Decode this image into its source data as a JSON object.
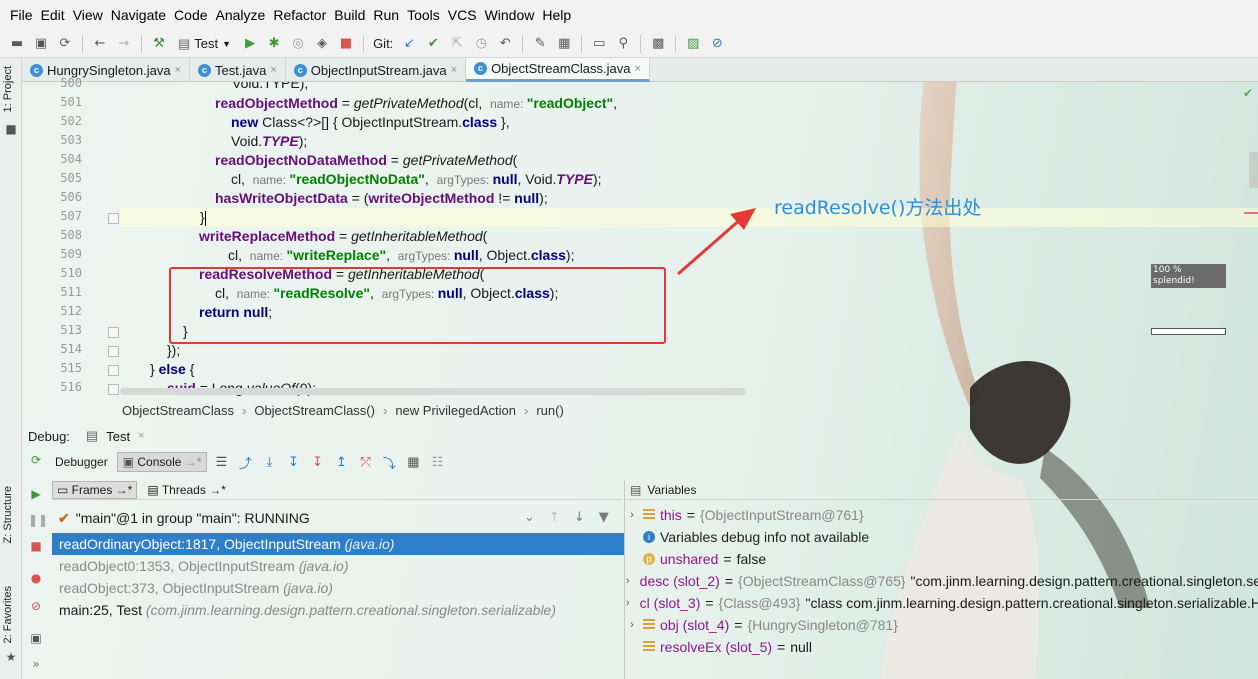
{
  "menu": [
    "File",
    "Edit",
    "View",
    "Navigate",
    "Code",
    "Analyze",
    "Refactor",
    "Build",
    "Run",
    "Tools",
    "VCS",
    "Window",
    "Help"
  ],
  "toolbar": {
    "run_config": "Test",
    "git_label": "Git:"
  },
  "left_strip": {
    "project_tab": "1: Project",
    "structure_tab": "Z: Structure",
    "favorites_tab": "2: Favorites"
  },
  "tabs": [
    {
      "label": "HungrySingleton.java",
      "active": false
    },
    {
      "label": "Test.java",
      "active": false
    },
    {
      "label": "ObjectInputStream.java",
      "active": false
    },
    {
      "label": "ObjectStreamClass.java",
      "active": true
    }
  ],
  "gutter": [
    "500",
    "501",
    "502",
    "503",
    "504",
    "505",
    "506",
    "507",
    "508",
    "509",
    "510",
    "511",
    "512",
    "513",
    "514",
    "515",
    "516"
  ],
  "code": {
    "l500": "Void.TYPE);",
    "l501_a": "readObjectMethod",
    "l501_b": " = ",
    "l501_c": "getPrivateMethod",
    "l501_d": "(cl,  ",
    "l501_hint": "name: ",
    "l501_str": "\"readObject\"",
    "l501_e": ",",
    "l502_kw": "new",
    "l502_a": " Class<?>[] { ObjectInputStream.",
    "l502_kw2": "class",
    "l502_b": " },",
    "l503_a": "Void.",
    "l503_c": "TYPE",
    "l503_b": ");",
    "l504_a": "readObjectNoDataMethod",
    "l504_b": " = ",
    "l504_c": "getPrivateMethod",
    "l504_d": "(",
    "l505_a": "cl,  ",
    "l505_hint": "name: ",
    "l505_str": "\"readObjectNoData\"",
    "l505_b": ",  ",
    "l505_hint2": "argTypes: ",
    "l505_kw": "null",
    "l505_c": ", Void.",
    "l505_cst": "TYPE",
    "l505_d": ");",
    "l506_a": "hasWriteObjectData",
    "l506_b": " = (",
    "l506_c": "writeObjectMethod",
    "l506_d": " != ",
    "l506_kw": "null",
    "l506_e": ");",
    "l507": "}",
    "l508_a": "writeReplaceMethod",
    "l508_b": " = ",
    "l508_c": "getInheritableMethod",
    "l508_d": "(",
    "l509_a": "cl,  ",
    "l509_hint": "name: ",
    "l509_str": "\"writeReplace\"",
    "l509_b": ",  ",
    "l509_hint2": "argTypes: ",
    "l509_kw": "null",
    "l509_c": ", Object.",
    "l509_kw2": "class",
    "l509_d": ");",
    "l510_a": "readResolveMethod",
    "l510_b": " = ",
    "l510_c": "getInheritableMethod",
    "l510_d": "(",
    "l511_a": "cl,  ",
    "l511_hint": "name: ",
    "l511_str": "\"readResolve\"",
    "l511_b": ",  ",
    "l511_hint2": "argTypes: ",
    "l511_kw": "null",
    "l511_c": ", Object.",
    "l511_kw2": "class",
    "l511_d": ");",
    "l512_kw": "return",
    "l512_sp": " ",
    "l512_kw2": "null",
    "l512_a": ";",
    "l513": "}",
    "l514": "});",
    "l515_a": "} ",
    "l515_kw": "else",
    "l515_b": " {",
    "l516_a": "suid",
    "l516_b": " = Long.",
    "l516_c": "valueOf",
    "l516_d": "(0);"
  },
  "annotation": "readResolve()方法出处",
  "right_badge": {
    "line1": "100 %",
    "line2": "splendid!"
  },
  "breadcrumbs": [
    "ObjectStreamClass",
    "ObjectStreamClass()",
    "new PrivilegedAction",
    "run()"
  ],
  "debug": {
    "label": "Debug:",
    "config": "Test",
    "tabs": {
      "debugger": "Debugger",
      "console": "Console"
    },
    "frames_tab": "Frames",
    "threads_tab": "Threads",
    "thread_selector": "\"main\"@1 in group \"main\": RUNNING",
    "frames": [
      {
        "method": "readOrdinaryObject:1817, ObjectInputStream",
        "pkg": "(java.io)"
      },
      {
        "method": "readObject0:1353, ObjectInputStream",
        "pkg": "(java.io)"
      },
      {
        "method": "readObject:373, ObjectInputStream",
        "pkg": "(java.io)"
      },
      {
        "method": "main:25, Test",
        "pkg": "(com.jinm.learning.design.pattern.creational.singleton.serializable)"
      }
    ],
    "variables_label": "Variables",
    "variables": [
      {
        "name": "this",
        "eq": " = ",
        "ref": "{ObjectInputStream@761}",
        "extra": ""
      },
      {
        "name": "",
        "eq": "",
        "ref": "",
        "extra": "Variables debug info not available"
      },
      {
        "name": "unshared",
        "eq": " = ",
        "ref": "",
        "extra": "false"
      },
      {
        "name": "desc (slot_2)",
        "eq": " = ",
        "ref": "{ObjectStreamClass@765}",
        "extra": " \"com.jinm.learning.design.pattern.creational.singleton.serializable.HungrySingleton\""
      },
      {
        "name": "cl (slot_3)",
        "eq": " = ",
        "ref": "{Class@493}",
        "extra": " \"class com.jinm.learning.design.pattern.creational.singleton.serializable.HungrySingleton\""
      },
      {
        "name": "obj (slot_4)",
        "eq": " = ",
        "ref": "{HungrySingleton@781}",
        "extra": ""
      },
      {
        "name": "resolveEx (slot_5)",
        "eq": " = ",
        "ref": "",
        "extra": "null"
      }
    ]
  },
  "colors": {
    "keyword": "#000080",
    "field": "#660e7a",
    "string": "#008000",
    "annotation_text": "#2b8fe0",
    "highlight_box": "#e53935",
    "selection": "#2f7ec9"
  }
}
